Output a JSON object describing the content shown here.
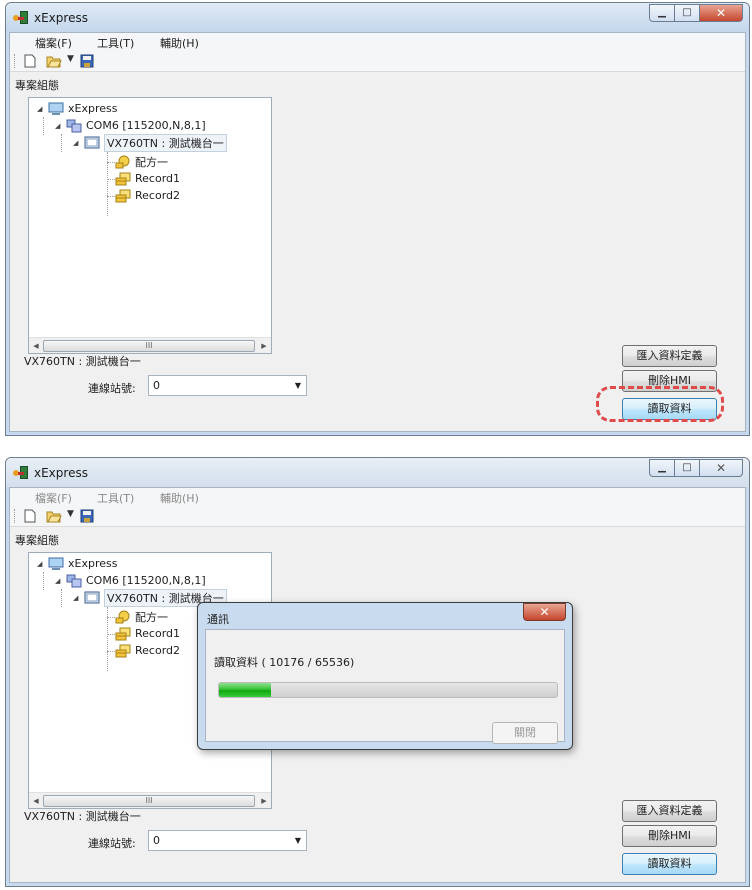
{
  "app": {
    "title": "xExpress"
  },
  "menu": {
    "file": "檔案(F)",
    "tools": "工具(T)",
    "help": "輔助(H)"
  },
  "toolbar": {
    "icons": [
      "new-document-icon",
      "open-folder-icon",
      "dropdown-arrow-icon",
      "save-icon"
    ]
  },
  "project": {
    "group_label": "專案組態",
    "tree": {
      "root": "xExpress",
      "port": "COM6 [115200,N,8,1]",
      "device": "VX760TN : 測試機台一",
      "items": [
        "配方一",
        "Record1",
        "Record2"
      ]
    },
    "scroll_thumb_glyph": "III"
  },
  "device_panel": {
    "title": "VX760TN : 測試機台一",
    "station_label": "連線站號:",
    "station_value": "0"
  },
  "buttons": {
    "import": "匯入資料定義",
    "delete_hmi": "刪除HMI",
    "read_data": "讀取資料"
  },
  "dialog": {
    "title": "通訊",
    "message": "讀取資料 ( 10176 / 65536)",
    "progress": 0.155,
    "close_label": "關閉"
  },
  "colors": {
    "highlight": "#e04a4a",
    "progress": "#11a711",
    "window_frame": "#c6d9ee"
  }
}
